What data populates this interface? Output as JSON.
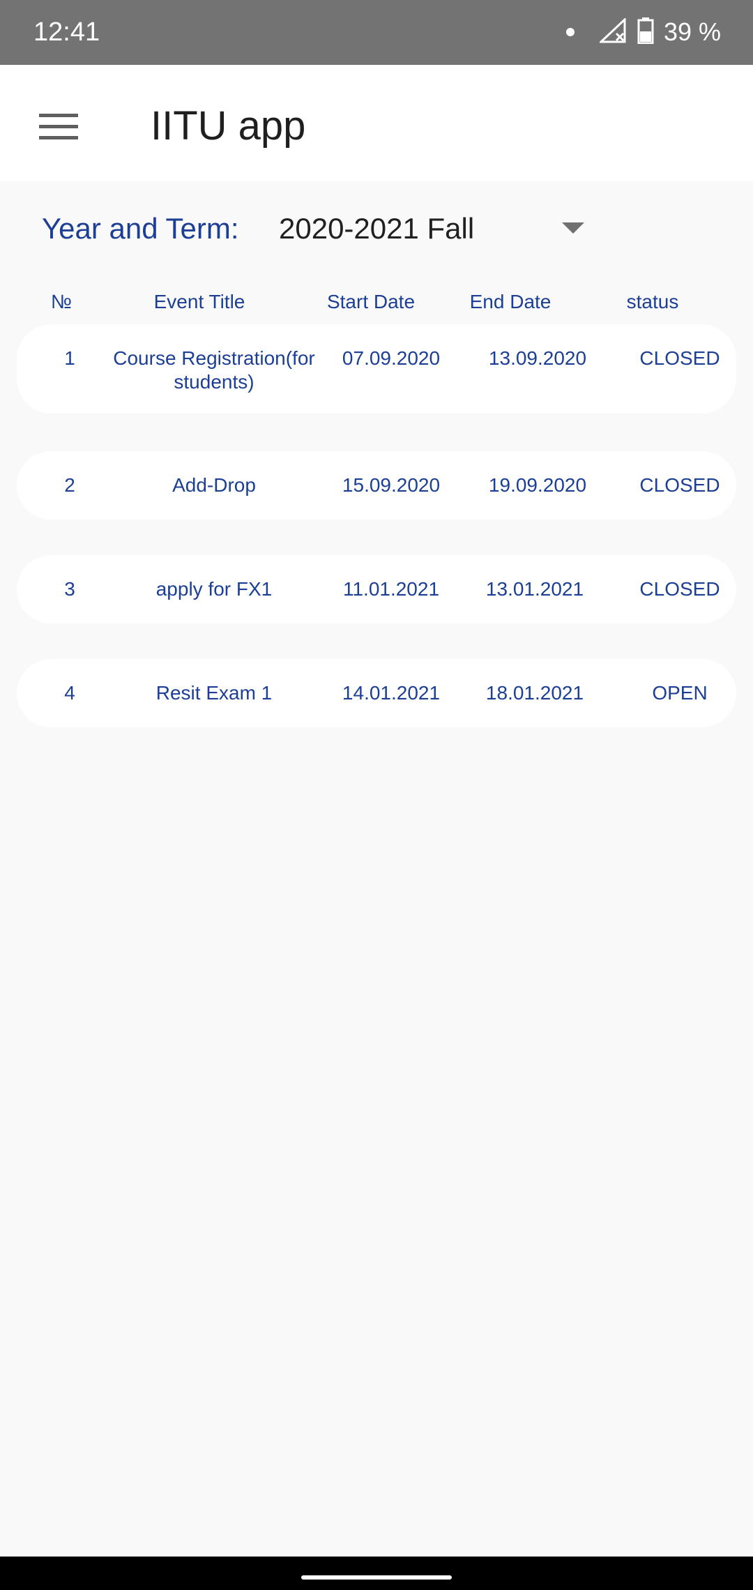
{
  "status_bar": {
    "time": "12:41",
    "battery_text": "39 %"
  },
  "app_bar": {
    "title": "IITU app"
  },
  "term": {
    "label": "Year and Term:",
    "selected": "2020-2021 Fall"
  },
  "table": {
    "headers": [
      "№",
      "Event Title",
      "Start Date",
      "End Date",
      "status"
    ],
    "rows": [
      {
        "num": "1",
        "title": "Course Registration(for students)",
        "start": "07.09.2020",
        "end": "13.09.2020",
        "status": "CLOSED"
      },
      {
        "num": "2",
        "title": "Add-Drop",
        "start": "15.09.2020",
        "end": "19.09.2020",
        "status": "CLOSED"
      },
      {
        "num": "3",
        "title": "apply for FX1",
        "start": "11.01.2021",
        "end": "13.01.2021",
        "status": "CLOSED"
      },
      {
        "num": "4",
        "title": "Resit Exam 1",
        "start": "14.01.2021",
        "end": "18.01.2021",
        "status": "OPEN"
      }
    ]
  },
  "colors": {
    "accent": "#1c3f95",
    "status_bar": "#737373",
    "background": "#f9f9f9"
  },
  "icons": {
    "menu": "hamburger-menu-icon",
    "dropdown": "chevron-down-icon",
    "signal": "signal-off-icon",
    "battery": "battery-icon"
  }
}
